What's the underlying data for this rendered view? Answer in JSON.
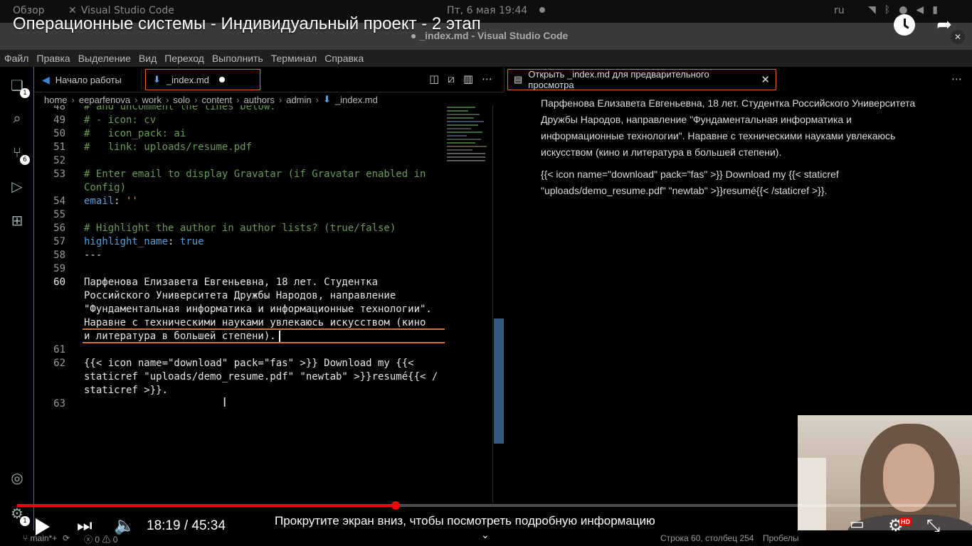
{
  "gnome": {
    "overview": "Обзор",
    "app": "Visual Studio Code",
    "clock": "Пт, 6 мая  19:44",
    "lang": "ru"
  },
  "youtube": {
    "title": "Операционные системы - Индивидуальный проект - 2 этап",
    "time": "18:19 / 45:34",
    "hint": "Прокрутите экран вниз, чтобы посмотреть подробную информацию",
    "progress_fraction": 0.403,
    "hd": "HD"
  },
  "window": {
    "title": "● _index.md - Visual Studio Code"
  },
  "menu": [
    "Файл",
    "Правка",
    "Выделение",
    "Вид",
    "Переход",
    "Выполнить",
    "Терминал",
    "Справка"
  ],
  "activity": {
    "explorer_badge": "1",
    "scm_badge": "6",
    "settings_badge": "1"
  },
  "tabs": {
    "welcome": "Начало работы",
    "file": "_index.md"
  },
  "breadcrumb": [
    "home",
    "eeparfenova",
    "work",
    "solo",
    "content",
    "authors",
    "admin",
    "_index.md"
  ],
  "editor_lines": [
    {
      "n": "48",
      "text": "# and uncomment the lines below."
    },
    {
      "n": "49",
      "text": "# - icon: cv"
    },
    {
      "n": "50",
      "text": "#   icon_pack: ai"
    },
    {
      "n": "51",
      "text": "#   link: uploads/resume.pdf"
    },
    {
      "n": "52",
      "text": ""
    },
    {
      "n": "53",
      "text": "# Enter email to display Gravatar (if Gravatar enabled in"
    },
    {
      "n": "",
      "text": "Config)"
    },
    {
      "n": "54",
      "key": "email",
      "value": "''"
    },
    {
      "n": "55",
      "text": ""
    },
    {
      "n": "56",
      "text": "# Highlight the author in author lists? (true/false)"
    },
    {
      "n": "57",
      "key": "highlight_name",
      "value": "true"
    },
    {
      "n": "58",
      "text": "---"
    },
    {
      "n": "59",
      "text": ""
    },
    {
      "n": "60",
      "text": "Парфенова Елизавета Евгеньевна, 18 лет. Студентка"
    },
    {
      "n": "",
      "text": "Российского Университета Дружбы Народов, направление"
    },
    {
      "n": "",
      "text": "\"Фундаментальная информатика и информационные технологии\"."
    },
    {
      "n": "",
      "text": "Наравне с техническими науками увлекаюсь искусством (кино"
    },
    {
      "n": "",
      "text": "и литература в большей степени)."
    },
    {
      "n": "61",
      "text": ""
    },
    {
      "n": "62",
      "text": "{{< icon name=\"download\" pack=\"fas\" >}} Download my {{<"
    },
    {
      "n": "",
      "text": "staticref \"uploads/demo_resume.pdf\" \"newtab\" >}}resumé{{< /"
    },
    {
      "n": "",
      "text": "staticref >}}."
    },
    {
      "n": "63",
      "text": ""
    }
  ],
  "preview": {
    "tab": "Открыть _index.md для предварительного просмотра",
    "para1": "Парфенова Елизавета Евгеньевна, 18 лет. Студентка Российского Университета Дружбы Народов, направление \"Фундаментальная информатика и информационные технологии\". Наравне с техническими науками увлекаюсь искусством (кино и литература в большей степени).",
    "para2": "{{< icon name=\"download\" pack=\"fas\" >}} Download my {{< staticref \"uploads/demo_resume.pdf\" \"newtab\" >}}resumé{{< /staticref >}}."
  },
  "status": {
    "branch": "main*+",
    "errors": "0",
    "warnings": "0",
    "position": "Строка 60, столбец 254",
    "spaces": "Пробелы"
  },
  "colors": {
    "accent": "#d8702d",
    "comment": "#6a9955",
    "keyword": "#569cd6",
    "string": "#ce9178",
    "progress": "#ff0000"
  }
}
